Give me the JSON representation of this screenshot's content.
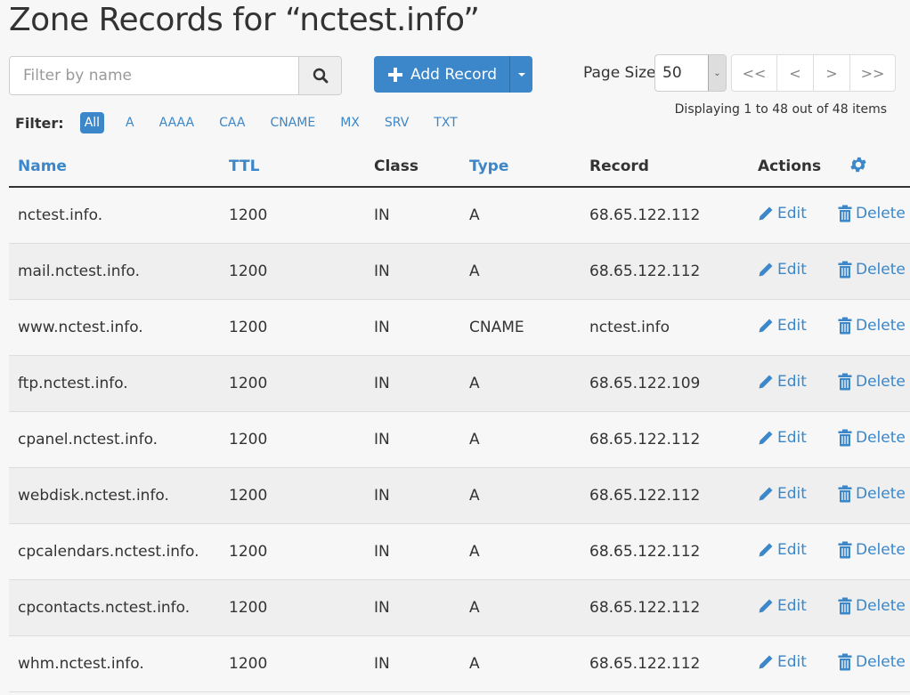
{
  "page": {
    "title": "Zone Records for “nctest.info”"
  },
  "search": {
    "placeholder": "Filter by name",
    "value": "",
    "icon": "search-icon"
  },
  "toolbar": {
    "add_label": "Add Record",
    "add_icon": "plus-icon"
  },
  "pagination": {
    "page_size_label": "Page Size",
    "page_size_value": "50",
    "buttons": [
      "<<",
      "<",
      ">",
      ">>"
    ],
    "display_info": "Displaying 1 to 48 out of 48 items"
  },
  "filter": {
    "label": "Filter:",
    "options": [
      "All",
      "A",
      "AAAA",
      "CAA",
      "CNAME",
      "MX",
      "SRV",
      "TXT"
    ],
    "active": "All"
  },
  "table": {
    "headers": {
      "name": "Name",
      "ttl": "TTL",
      "class": "Class",
      "type": "Type",
      "record": "Record",
      "actions": "Actions"
    },
    "edit_label": "Edit",
    "delete_label": "Delete",
    "rows": [
      {
        "name": "nctest.info.",
        "ttl": "1200",
        "class": "IN",
        "type": "A",
        "record": "68.65.122.112"
      },
      {
        "name": "mail.nctest.info.",
        "ttl": "1200",
        "class": "IN",
        "type": "A",
        "record": "68.65.122.112"
      },
      {
        "name": "www.nctest.info.",
        "ttl": "1200",
        "class": "IN",
        "type": "CNAME",
        "record": "nctest.info"
      },
      {
        "name": "ftp.nctest.info.",
        "ttl": "1200",
        "class": "IN",
        "type": "A",
        "record": "68.65.122.109"
      },
      {
        "name": "cpanel.nctest.info.",
        "ttl": "1200",
        "class": "IN",
        "type": "A",
        "record": "68.65.122.112"
      },
      {
        "name": "webdisk.nctest.info.",
        "ttl": "1200",
        "class": "IN",
        "type": "A",
        "record": "68.65.122.112"
      },
      {
        "name": "cpcalendars.nctest.info.",
        "ttl": "1200",
        "class": "IN",
        "type": "A",
        "record": "68.65.122.112"
      },
      {
        "name": "cpcontacts.nctest.info.",
        "ttl": "1200",
        "class": "IN",
        "type": "A",
        "record": "68.65.122.112"
      },
      {
        "name": "whm.nctest.info.",
        "ttl": "1200",
        "class": "IN",
        "type": "A",
        "record": "68.65.122.112"
      }
    ]
  },
  "colors": {
    "accent": "#3b87c9",
    "text": "#333333",
    "background": "#f7f7f7",
    "row_alt": "#efefef"
  }
}
